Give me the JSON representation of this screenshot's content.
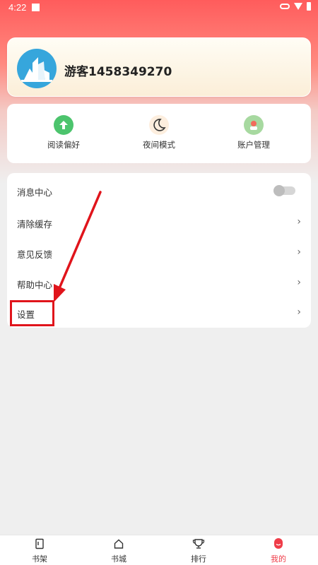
{
  "status_bar": {
    "time": "4:22"
  },
  "profile": {
    "username": "游客1458349270"
  },
  "quick_actions": [
    {
      "label": "阅读偏好",
      "icon": "arrow-up-icon"
    },
    {
      "label": "夜间模式",
      "icon": "moon-icon"
    },
    {
      "label": "账户管理",
      "icon": "account-icon"
    }
  ],
  "menu": {
    "items": [
      {
        "label": "消息中心",
        "control": "toggle",
        "toggle_on": false
      },
      {
        "label": "清除缓存",
        "control": "chevron"
      },
      {
        "label": "意见反馈",
        "control": "chevron"
      },
      {
        "label": "帮助中心",
        "control": "chevron"
      },
      {
        "label": "设置",
        "control": "chevron"
      }
    ],
    "chevron": "›"
  },
  "bottom_nav": [
    {
      "label": "书架",
      "icon": "bookshelf-icon",
      "active": false
    },
    {
      "label": "书城",
      "icon": "home-icon",
      "active": false
    },
    {
      "label": "排行",
      "icon": "trophy-icon",
      "active": false
    },
    {
      "label": "我的",
      "icon": "profile-icon",
      "active": true
    }
  ],
  "colors": {
    "accent": "#ef3c48",
    "header_red": "#ff5c5c",
    "annotation_red": "#e0141b",
    "avatar_blue": "#36a6dc"
  }
}
